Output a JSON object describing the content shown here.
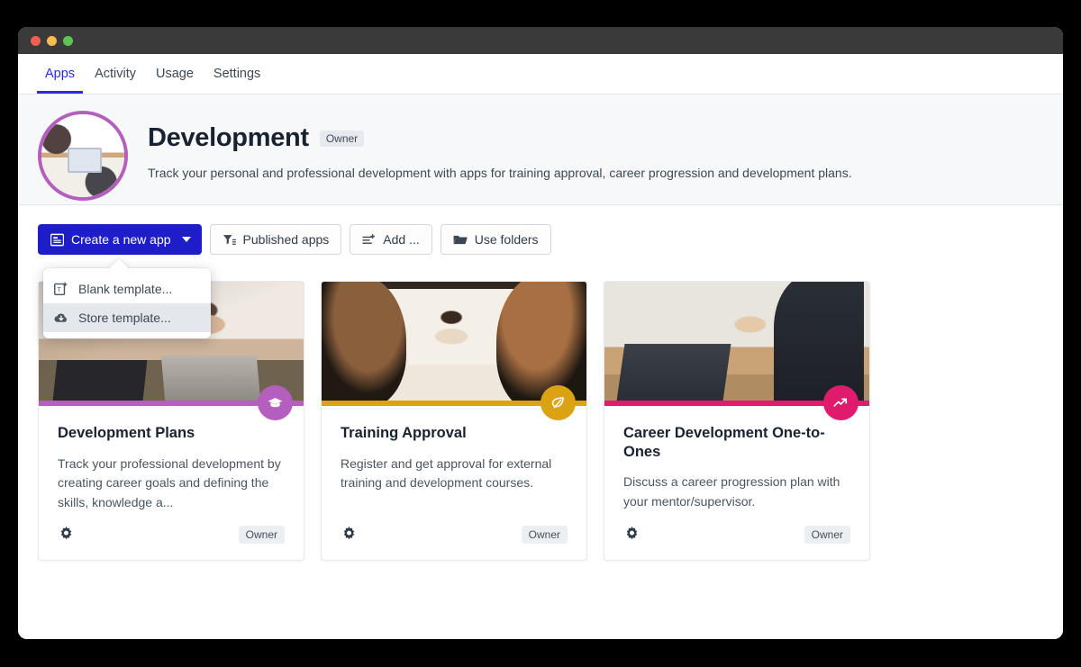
{
  "window": {
    "traffic_lights": [
      "close",
      "minimize",
      "maximize"
    ]
  },
  "tabs": [
    {
      "label": "Apps",
      "active": true
    },
    {
      "label": "Activity",
      "active": false
    },
    {
      "label": "Usage",
      "active": false
    },
    {
      "label": "Settings",
      "active": false
    }
  ],
  "header": {
    "avatar_alt": "workspace-photo",
    "title": "Development",
    "badge": "Owner",
    "description": "Track your personal and professional development with apps for training approval, career progression and development plans."
  },
  "toolbar": {
    "create_label": "Create a new app",
    "published_label": "Published apps",
    "add_label": "Add ...",
    "folders_label": "Use folders"
  },
  "dropdown": {
    "items": [
      {
        "label": "Blank template...",
        "hover": false
      },
      {
        "label": "Store template...",
        "hover": true
      }
    ]
  },
  "cards": [
    {
      "title": "Development Plans",
      "description": "Track your professional development by creating career goals and defining the skills, knowledge a...",
      "badge": "Owner",
      "accent": "#b45fbe",
      "icon": "graduation-cap-icon",
      "photo": "cafe-laptop-photo"
    },
    {
      "title": "Training Approval",
      "description": "Register and get approval for external training and development courses.",
      "badge": "Owner",
      "accent": "#ddа",
      "accent_color": "#dba214",
      "icon": "leaf-icon",
      "photo": "meeting-room-photo"
    },
    {
      "title": "Career Development One-to-Ones",
      "description": "Discuss a career progression plan with your mentor/supervisor.",
      "badge": "Owner",
      "accent_color": "#e01a6c",
      "icon": "chart-line-icon",
      "photo": "mentoring-laptop-photo"
    }
  ],
  "colors": {
    "primary_blue": "#1d1dc9",
    "purple": "#b45fbe",
    "gold": "#dba214",
    "pink": "#e01a6c",
    "header_bg": "#f6f8fa"
  }
}
